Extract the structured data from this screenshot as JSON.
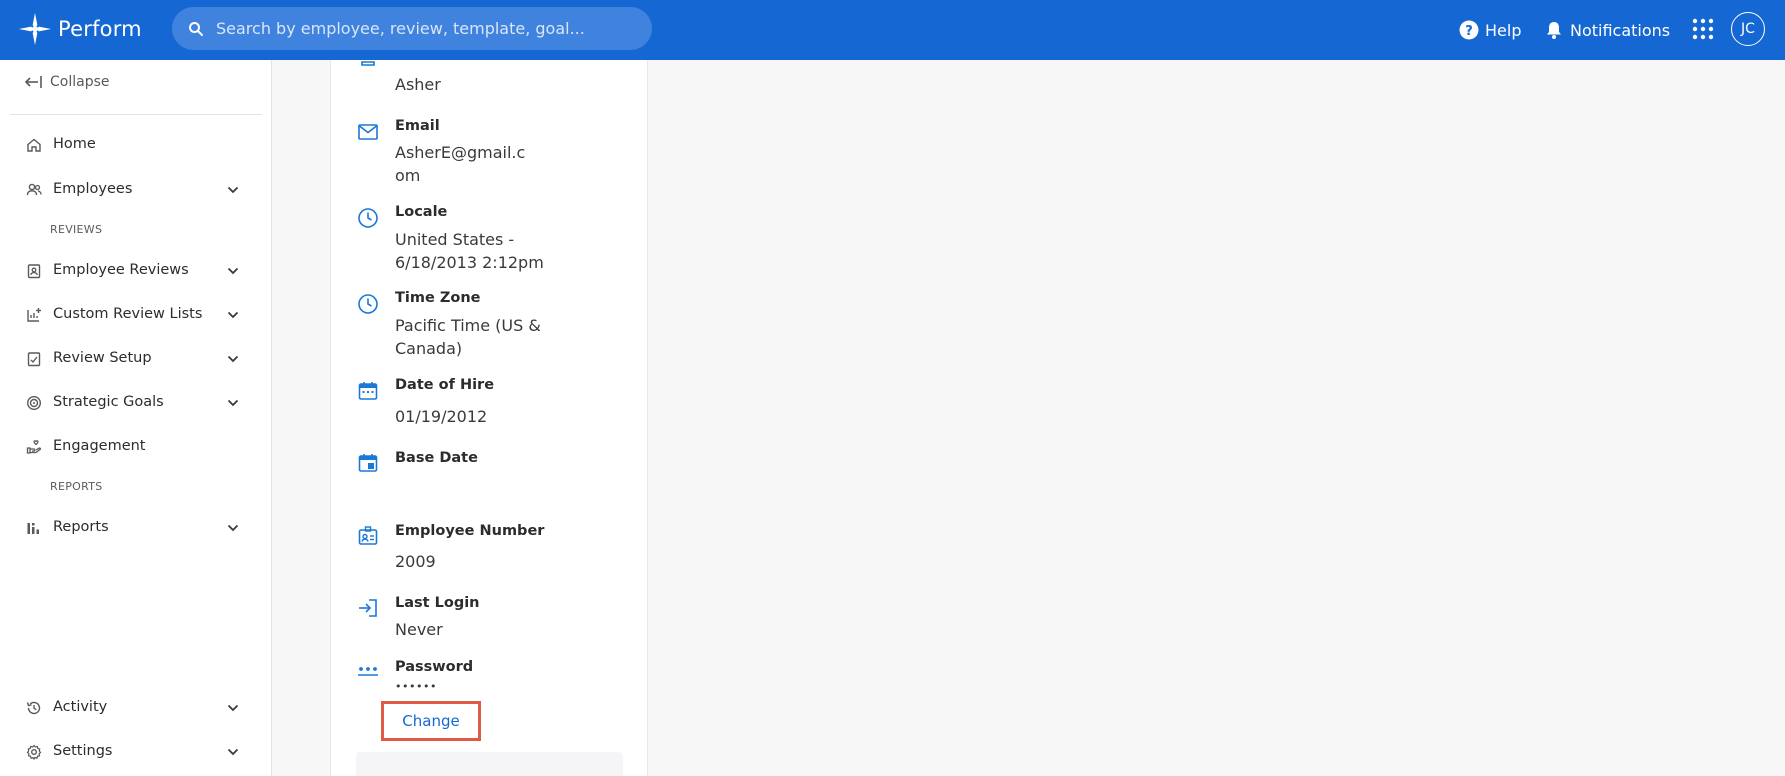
{
  "header": {
    "brand": "Perform",
    "search_placeholder": "Search by employee, review, template, goal...",
    "help_label": "Help",
    "notifications_label": "Notifications",
    "avatar_initials": "JC"
  },
  "sidebar": {
    "collapse_label": "Collapse",
    "items": [
      {
        "label": "Home",
        "icon": "home-icon"
      },
      {
        "label": "Employees",
        "icon": "people-icon"
      },
      {
        "label": "Employee Reviews",
        "icon": "clipboard-user-icon"
      },
      {
        "label": "Custom Review Lists",
        "icon": "chart-plus-icon"
      },
      {
        "label": "Review Setup",
        "icon": "checklist-icon"
      },
      {
        "label": "Strategic Goals",
        "icon": "target-icon"
      },
      {
        "label": "Engagement",
        "icon": "hand-heart-icon"
      },
      {
        "label": "Reports",
        "icon": "bar-chart-icon"
      },
      {
        "label": "Activity",
        "icon": "history-icon"
      },
      {
        "label": "Settings",
        "icon": "gear-icon"
      }
    ],
    "section_reviews": "REVIEWS",
    "section_reports": "REPORTS"
  },
  "profile": {
    "name_value": "Asher",
    "email_label": "Email",
    "email_line1": "AsherE@gmail.c",
    "email_line2": "om",
    "locale_label": "Locale",
    "locale_line1": "United States -",
    "locale_line2": "6/18/2013 2:12pm",
    "timezone_label": "Time Zone",
    "timezone_line1": "Pacific Time (US &",
    "timezone_line2": "Canada)",
    "hire_label": "Date of Hire",
    "hire_value": "01/19/2012",
    "base_label": "Base Date",
    "empnum_label": "Employee Number",
    "empnum_value": "2009",
    "login_label": "Last Login",
    "login_value": "Never",
    "password_label": "Password",
    "password_value": "••••••",
    "change_label": "Change"
  },
  "colors": {
    "brand_blue": "#1567d3",
    "icon_blue": "#1a78d6",
    "highlight_red": "#e05a48"
  }
}
